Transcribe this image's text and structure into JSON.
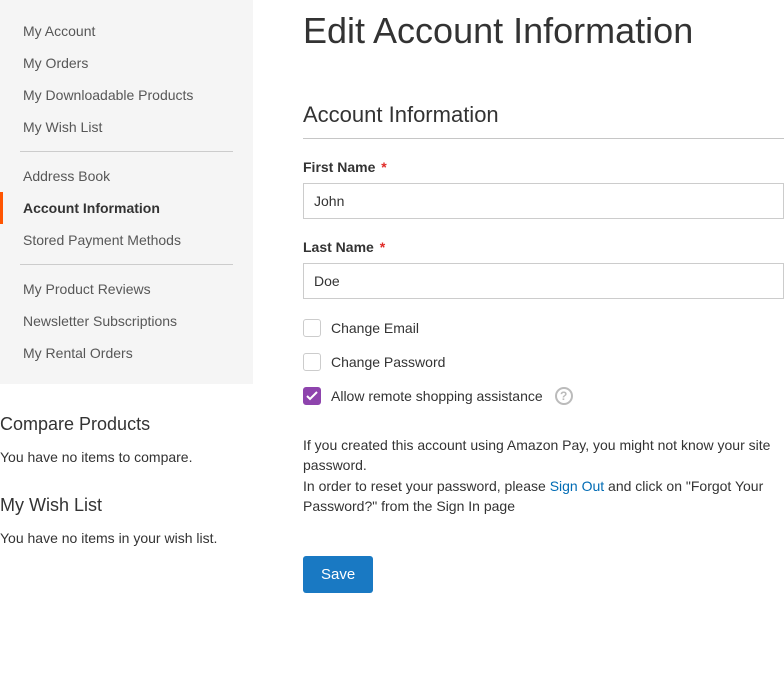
{
  "sidebar": {
    "nav": [
      {
        "label": "My Account"
      },
      {
        "label": "My Orders"
      },
      {
        "label": "My Downloadable Products"
      },
      {
        "label": "My Wish List"
      },
      {
        "label": "Address Book"
      },
      {
        "label": "Account Information"
      },
      {
        "label": "Stored Payment Methods"
      },
      {
        "label": "My Product Reviews"
      },
      {
        "label": "Newsletter Subscriptions"
      },
      {
        "label": "My Rental Orders"
      }
    ],
    "compare": {
      "title": "Compare Products",
      "empty": "You have no items to compare."
    },
    "wishlist": {
      "title": "My Wish List",
      "empty": "You have no items in your wish list."
    }
  },
  "main": {
    "page_title": "Edit Account Information",
    "section_title": "Account Information",
    "first_name_label": "First Name",
    "first_name_value": "John",
    "last_name_label": "Last Name",
    "last_name_value": "Doe",
    "change_email_label": "Change Email",
    "change_password_label": "Change Password",
    "allow_remote_label": "Allow remote shopping assistance",
    "info_line1": "If you created this account using Amazon Pay, you might not know your site password.",
    "info_line2_a": "In order to reset your password, please ",
    "info_line2_link": "Sign Out",
    "info_line2_b": " and click on \"Forgot Your Password?\" from the Sign In page",
    "save_label": "Save"
  }
}
